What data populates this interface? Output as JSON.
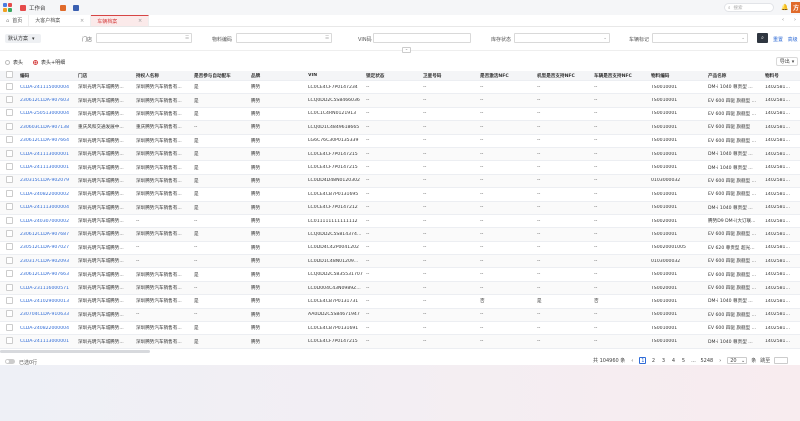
{
  "topbar": {
    "workbench_label": "工作台",
    "search_placeholder": "搜索",
    "avatar_text": "方"
  },
  "tabs": [
    {
      "label": "首页"
    },
    {
      "label": "大客户档案"
    },
    {
      "label": "车辆档案",
      "active": true
    }
  ],
  "filter": {
    "scheme_label": "默认方案",
    "fields": [
      {
        "label": "门店",
        "value": ""
      },
      {
        "label": "物料编码",
        "value": ""
      },
      {
        "label": "VIN码",
        "value": ""
      },
      {
        "label": "库存状态",
        "value": ""
      },
      {
        "label": "车辆标记",
        "value": ""
      }
    ],
    "reset_label": "重置",
    "more_label": "高级"
  },
  "view_options": {
    "header_label": "表头",
    "header_detail_label": "表头+明细",
    "export_label": "导出"
  },
  "colors": {
    "accent": "#d64545",
    "link": "#2f6bd6"
  },
  "columns": [
    "编码",
    "门店",
    "持权人名称",
    "是否参与自动配车",
    "品牌",
    "VIN",
    "锁定状态",
    "卫星号码",
    "是否激活NFC",
    "机型是否支持NFC",
    "车辆是否支持NFC",
    "物料编码",
    "产品名称",
    "物料号"
  ],
  "rows": [
    [
      "CLDA-241115000004",
      "深圳光明汽车城腾势...",
      "深圳腾势汽车销售有...",
      "是",
      "腾势",
      "LC0CE4CF7P0147234",
      "--",
      "--",
      "--",
      "--",
      "--",
      "TS0010001",
      "DM-i 1040 尊贵型 ...",
      "14025819-00"
    ],
    [
      "230612CLDA-907603",
      "深圳光明汽车城腾势...",
      "深圳腾势汽车销售有...",
      "是",
      "腾势",
      "LCQ0DD2C5S8466036",
      "--",
      "--",
      "--",
      "--",
      "--",
      "TS0010001",
      "EV 600 四驱 旗舰型 ...",
      "14025819-00"
    ],
    [
      "CLDA-250513000004",
      "深圳光明汽车城腾势...",
      "深圳腾势汽车销售有...",
      "是",
      "腾势",
      "LC0C1C4RN0121913",
      "--",
      "--",
      "--",
      "--",
      "--",
      "TS0010001",
      "EV 600 四驱 旗舰型 ...",
      "14025819-00"
    ],
    [
      "230603CLDA-907138",
      "重庆风和交通发展中...",
      "重庆腾势汽车销售有...",
      "--",
      "腾势",
      "LCQ0D1C4849618665",
      "--",
      "--",
      "--",
      "--",
      "--",
      "TS0010001",
      "EV 600 四驱 旗舰型",
      "14025819-00"
    ],
    [
      "230612CLDA-907664",
      "深圳光明汽车城腾势...",
      "深圳腾势汽车销售有...",
      "是",
      "腾势",
      "LG6C76C30P0135339",
      "--",
      "--",
      "--",
      "--",
      "--",
      "TS0010001",
      "EV 600 四驱 旗舰型 ...",
      "14025819-00"
    ],
    [
      "CLDA-241113000001",
      "深圳光明汽车城腾势...",
      "深圳腾势汽车销售有...",
      "是",
      "腾势",
      "LC0CE4CF7P0147215",
      "--",
      "--",
      "--",
      "--",
      "--",
      "TS0010001",
      "DM-i 1040 尊贵型 ...",
      "14025819-00"
    ],
    [
      "CLDA-241113000001",
      "深圳光明汽车城腾势...",
      "深圳腾势汽车销售有...",
      "是",
      "腾势",
      "LC0CE4CF7P0147215",
      "--",
      "--",
      "--",
      "--",
      "--",
      "TS0010001",
      "DM-i 1040 尊贵型 ...",
      "14025819-00"
    ],
    [
      "230315CLDA-902079",
      "深圳光明汽车城腾势...",
      "深圳腾势汽车销售有...",
      "是",
      "腾势",
      "LC0DD4D48N0120302",
      "--",
      "--",
      "--",
      "--",
      "--",
      "0103000032",
      "EV 600 四驱 旗舰型 ...",
      "14025819-00"
    ],
    [
      "CLDA-240822000002",
      "深圳光明汽车城腾势...",
      "深圳腾势汽车销售有...",
      "是",
      "腾势",
      "LC0CE4CB7P0131695",
      "--",
      "--",
      "--",
      "--",
      "--",
      "TS0010001",
      "EV 600 四驱 旗舰型 ...",
      "14025819-00"
    ],
    [
      "CLDA-241113000004",
      "深圳光明汽车城腾势...",
      "深圳腾势汽车销售有...",
      "是",
      "腾势",
      "LC0CE4CF7P0147212",
      "--",
      "--",
      "--",
      "--",
      "--",
      "TS0010001",
      "DM-i 1040 尊贵型 ...",
      "14025819-00"
    ],
    [
      "CLDA-240307000002",
      "深圳光明汽车城腾势...",
      "--",
      "--",
      "腾势",
      "LC011111111111112",
      "--",
      "--",
      "--",
      "--",
      "--",
      "TS0020001",
      "腾势D9 DM-i(大订联...",
      "14025819-00"
    ],
    [
      "230612CLDA-907687",
      "深圳光明汽车城腾势...",
      "深圳腾势汽车销售有...",
      "是",
      "腾势",
      "LCQ0DD2C5S814374827",
      "--",
      "--",
      "--",
      "--",
      "--",
      "TS0010001",
      "EV 600 四驱 旗舰型 ...",
      "14025819-00"
    ],
    [
      "230512CLDA-907027",
      "深圳光明汽车城腾势...",
      "--",
      "--",
      "腾势",
      "LC0DD4C42P0041202",
      "--",
      "--",
      "--",
      "--",
      "--",
      "TS0020001005",
      "EV 620 尊贵型 超光...",
      "14025819-00"
    ],
    [
      "230317CLDA-902093",
      "深圳光明汽车城腾势...",
      "--",
      "--",
      "腾势",
      "LC0DD1C48N01209...",
      "--",
      "--",
      "--",
      "--",
      "--",
      "0103000032",
      "EV 600 四驱 旗舰型 ...",
      "14025819-00"
    ],
    [
      "230612CLDA-907663",
      "深圳光明汽车城腾势...",
      "深圳腾势汽车销售有...",
      "是",
      "腾势",
      "LCQ0DD2C5835531707",
      "--",
      "--",
      "--",
      "--",
      "--",
      "TS0010001",
      "EV 600 四驱 旗舰型 ...",
      "14025819-00"
    ],
    [
      "CLDA-231116000571",
      "深圳光明汽车城腾势...",
      "深圳腾势汽车销售有...",
      "--",
      "腾势",
      "LC0D004C43N0989Z...",
      "--",
      "--",
      "--",
      "--",
      "--",
      "TS0020001",
      "EV 600 四驱 旗舰型 ...",
      "14025819-00"
    ],
    [
      "CLDA-241029000013",
      "深圳光明汽车城腾势...",
      "深圳腾势汽车销售有...",
      "是",
      "腾势",
      "LC0CE4CB7P0131731",
      "--",
      "--",
      "否",
      "是",
      "否",
      "TS0010001",
      "DM-i 1040 尊贵型 ...",
      "14025819-00"
    ],
    [
      "230704CLDA-910633",
      "深圳光明汽车城腾势...",
      "--",
      "--",
      "腾势",
      "AA0DD2C5S84671947",
      "--",
      "--",
      "--",
      "--",
      "--",
      "TS0010001",
      "EV 600 四驱 旗舰型 ...",
      "14025819-00"
    ],
    [
      "CLDA-240822000004",
      "深圳光明汽车城腾势...",
      "深圳腾势汽车销售有...",
      "是",
      "腾势",
      "LC0CE4CB7P0131691",
      "--",
      "--",
      "--",
      "--",
      "--",
      "TS0010001",
      "EV 600 四驱 旗舰型 ...",
      "14025819-00"
    ],
    [
      "CLDA-241113000001",
      "深圳光明汽车城腾势...",
      "深圳腾势汽车销售有...",
      "是",
      "腾势",
      "LC0CE4CF7P0147215",
      "--",
      "--",
      "--",
      "--",
      "--",
      "TS0010001",
      "DM-i 1040 尊贵型 ...",
      "14025819-00"
    ]
  ],
  "footer": {
    "selected_label": "已选0行",
    "total_label": "共 104960 条",
    "pages": [
      "1",
      "2",
      "3",
      "4",
      "5",
      "...",
      "5248"
    ],
    "page_size": "20",
    "per_page_label": "条",
    "jump_label": "跳至"
  }
}
